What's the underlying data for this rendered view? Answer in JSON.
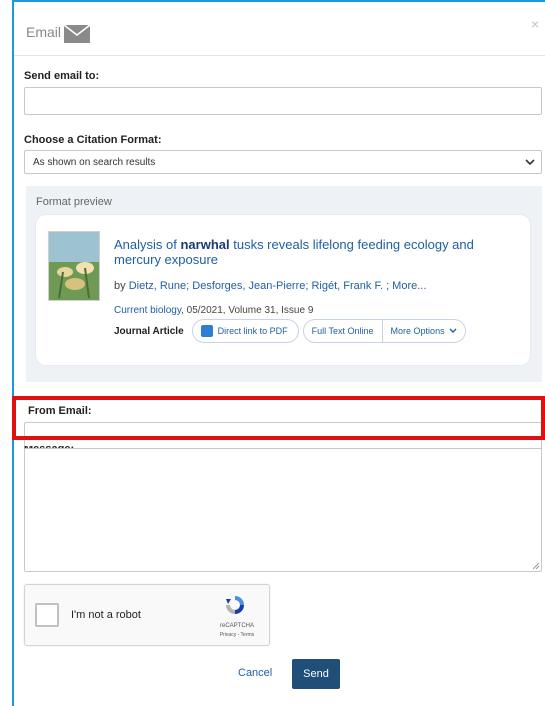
{
  "header": {
    "title": "Email",
    "close": "×"
  },
  "form": {
    "send_to_label": "Send email to:",
    "send_to_value": "",
    "citation_label": "Choose a Citation Format:",
    "citation_selected": "As shown on search results",
    "from_label": "From Email:",
    "from_value": "",
    "message_label": "Message:",
    "message_value": ""
  },
  "preview": {
    "label": "Format preview",
    "cover_text": "Current Biology",
    "title_before": "Analysis of ",
    "title_keyword": "narwhal",
    "title_after": " tusks reveals lifelong feeding ecology and mercury exposure",
    "authors_prefix": "by ",
    "authors": "Dietz, Rune; Desforges, Jean-Pierre; Rigét, Frank F. ; More...",
    "journal": "Current biology",
    "source_rest": ", 05/2021, Volume 31, Issue 9",
    "doc_type": "Journal Article",
    "pdf_link": "Direct link to PDF",
    "fulltext": "Full Text Online",
    "more_options": "More Options"
  },
  "captcha": {
    "label": "I'm not a robot",
    "brand": "reCAPTCHA",
    "links": "Privacy - Terms"
  },
  "actions": {
    "cancel": "Cancel",
    "send": "Send"
  },
  "colors": {
    "frame": "#1a9ad6",
    "highlight": "#e01010",
    "primary": "#1f4e79",
    "link": "#1f5fa3"
  }
}
